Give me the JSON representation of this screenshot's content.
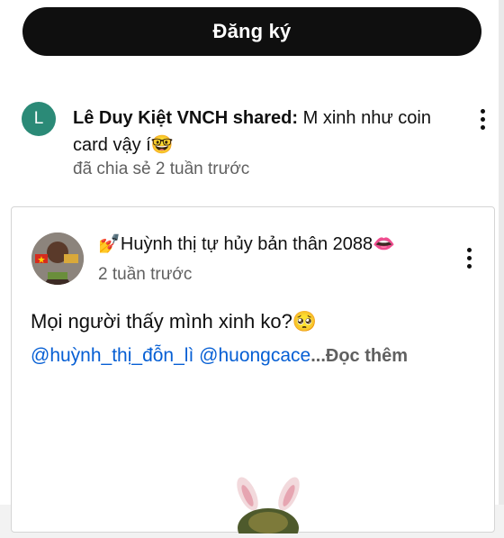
{
  "subscribe": {
    "label": "Đăng ký"
  },
  "shared_post": {
    "avatar_letter": "L",
    "author": "Lê Duy Kiệt VNCH shared:",
    "text": " M xinh như coin card vậy í",
    "emoji": "🤓",
    "time": "đã chia sẻ 2 tuần trước"
  },
  "original_post": {
    "author_prefix_emoji": "💅",
    "author": "Huỳnh thị tự hủy bản thân 2088",
    "author_suffix_emoji": "👄",
    "time": "2 tuần trước",
    "text": "Mọi người thấy mình xinh ko?",
    "emoji": "🥺",
    "tag1": "@huỳnh_thị_đỗn_lì",
    "tag2": "@huongcace",
    "ellipsis": "...",
    "read_more": "Đọc thêm"
  },
  "colors": {
    "link": "#065fd4",
    "avatar_bg": "#2b8a77",
    "button_bg": "#0f0f0f"
  },
  "icons": [
    "more-vert-icon",
    "more-vert-icon"
  ]
}
